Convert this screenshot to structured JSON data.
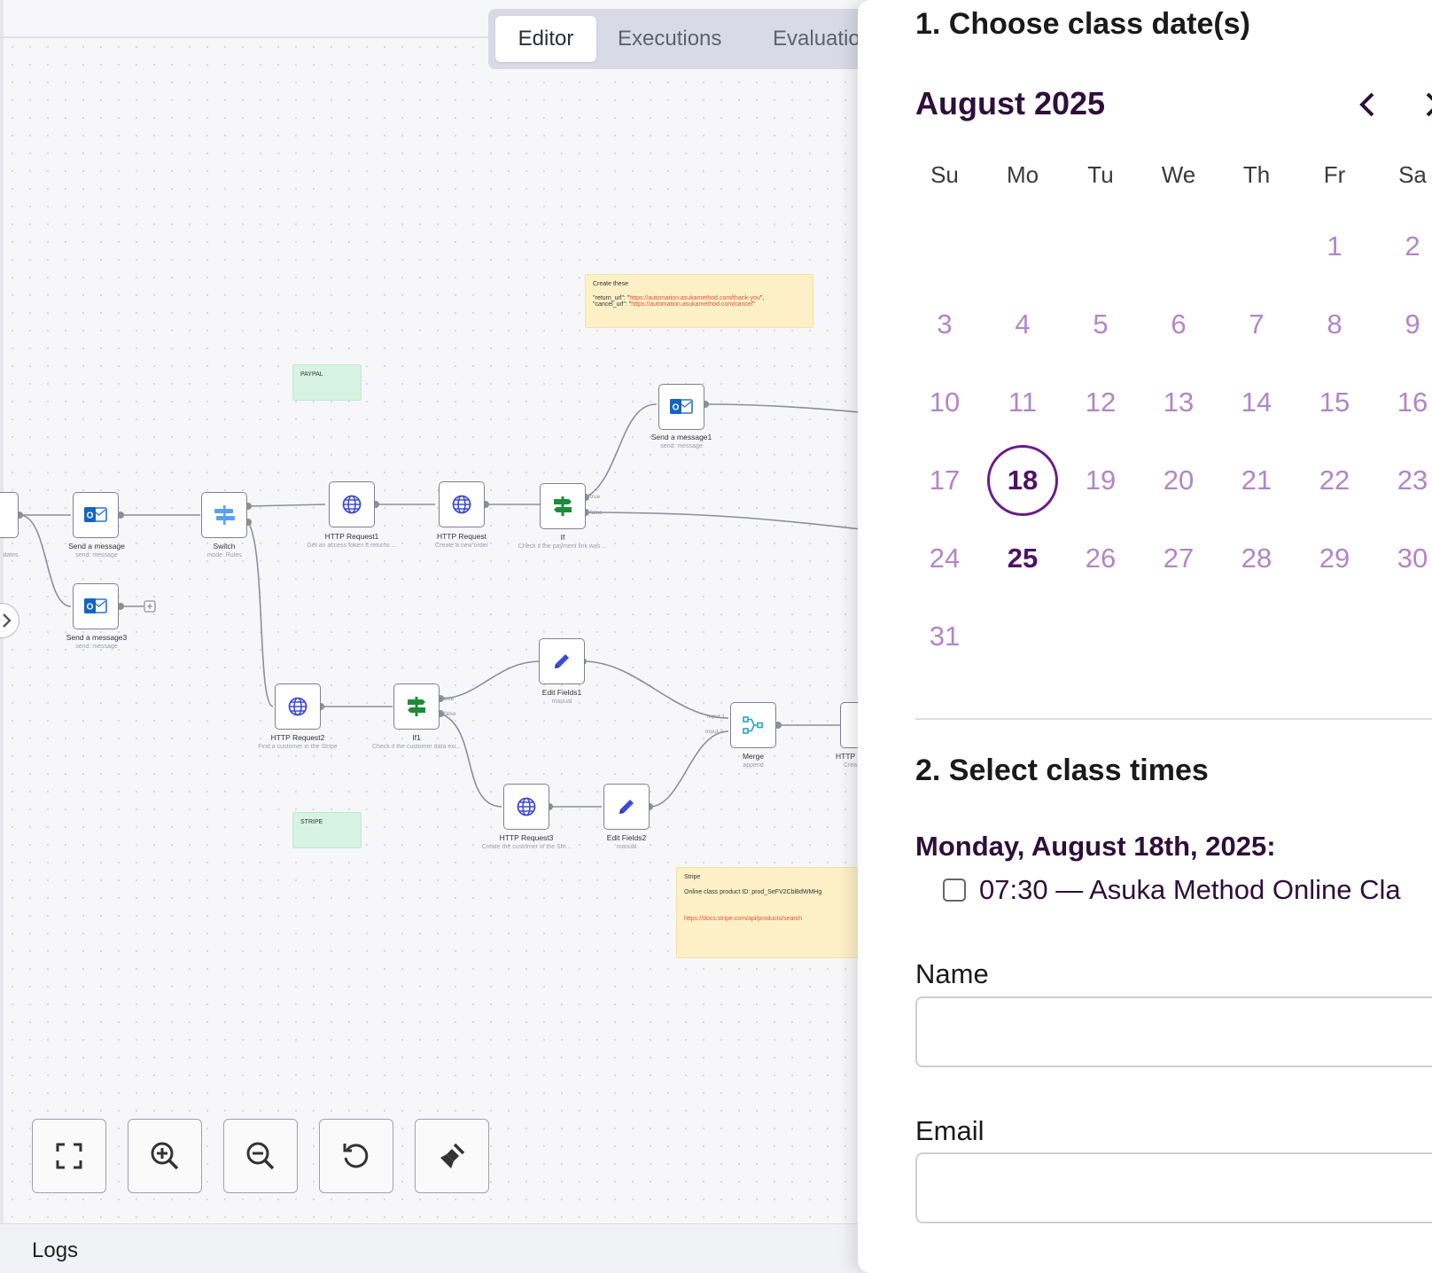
{
  "editor": {
    "tabs": [
      {
        "label": "Editor",
        "active": true
      },
      {
        "label": "Executions",
        "active": false
      },
      {
        "label": "Evaluatio",
        "active": false
      }
    ],
    "logs_label": "Logs",
    "nodes": {
      "trigger": {
        "title": "",
        "sub": "dates"
      },
      "send_message": {
        "title": "Send a message",
        "sub": "send: message"
      },
      "send_message3": {
        "title": "Send a message3",
        "sub": "send: message"
      },
      "switch": {
        "title": "Switch",
        "sub": "mode: Rules"
      },
      "http_request1": {
        "title": "HTTP Request1",
        "sub": "Get an access token It returns ..."
      },
      "http_request": {
        "title": "HTTP Request",
        "sub": "Create a new order"
      },
      "if": {
        "title": "If",
        "sub": "Check if the payment link was ..."
      },
      "send_message1": {
        "title": "Send a message1",
        "sub": "send: message"
      },
      "http_request2": {
        "title": "HTTP Request2",
        "sub": "Find a customer in the Stripe"
      },
      "if1": {
        "title": "If1",
        "sub": "Check if the customer data exi..."
      },
      "edit_fields1": {
        "title": "Edit Fields1",
        "sub": "manual"
      },
      "http_request3": {
        "title": "HTTP Request3",
        "sub": "Create the customer in the Stri..."
      },
      "edit_fields2": {
        "title": "Edit Fields2",
        "sub": "manual"
      },
      "merge": {
        "title": "Merge",
        "sub": "append"
      },
      "http_cut": {
        "title": "HTTP",
        "sub": "Crea"
      }
    },
    "port_labels": {
      "true": "true",
      "false": "false",
      "input1": "Input 1",
      "input2": "Input 2"
    },
    "stickies": {
      "create": {
        "title": "Create these",
        "line1_key": "\"return_url\": \"",
        "line1_url": "https://automation.asukamethod.com/thank-you",
        "line1_end": "\",",
        "line2_key": "\"cancel_url\": \"",
        "line2_url": "https://automation.asukamethod.com/cancel",
        "line2_end": "\""
      },
      "paypal": {
        "title": "PAYPAL"
      },
      "stripe_group": {
        "title": "STRIPE"
      },
      "stripe_note": {
        "title": "Stripe",
        "line1": "Online class product ID: prod_SeFV2Cbl8dWMHg",
        "url": "https://docs.stripe.com/api/products/search"
      }
    },
    "controls": [
      "fit-view",
      "zoom-in",
      "zoom-out",
      "reset",
      "tidy-up"
    ]
  },
  "booking": {
    "step1_title": "1. Choose class date(s)",
    "month_title": "August 2025",
    "weekdays": [
      "Su",
      "Mo",
      "Tu",
      "We",
      "Th",
      "Fr",
      "Sa"
    ],
    "days": [
      "1",
      "2",
      "3",
      "4",
      "5",
      "6",
      "7",
      "8",
      "9",
      "10",
      "11",
      "12",
      "13",
      "14",
      "15",
      "16",
      "17",
      "18",
      "19",
      "20",
      "21",
      "22",
      "23",
      "24",
      "25",
      "26",
      "27",
      "28",
      "29",
      "30",
      "31"
    ],
    "first_weekday_index": 5,
    "selected_day": "18",
    "today_day": "25",
    "step2_title": "2. Select class times",
    "date_heading": "Monday, August 18th, 2025:",
    "slot_label": "07:30 — Asuka Method Online Cla",
    "slot_checked": false,
    "name_label": "Name",
    "name_value": "",
    "email_label": "Email",
    "email_value": "",
    "colors": {
      "accent": "#6a1d86",
      "day_text": "#b385c6",
      "heading": "#2f0f3a"
    }
  }
}
